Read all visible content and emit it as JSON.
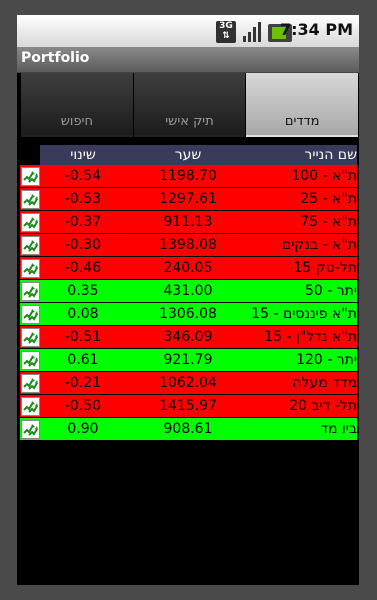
{
  "status_bar": {
    "network": "3G",
    "time": "7:34 PM",
    "icons": [
      "3g-icon",
      "signal-icon",
      "battery-icon"
    ]
  },
  "app": {
    "title": "Portfolio"
  },
  "tabs": [
    {
      "label": "חיפוש",
      "selected": false
    },
    {
      "label": "תיק אישי",
      "selected": false
    },
    {
      "label": "מדדים",
      "selected": true
    }
  ],
  "table": {
    "headers": {
      "name": "שם הנייר",
      "price": "שער",
      "change": "שינוי"
    },
    "rows": [
      {
        "name": "ת\"א - 100",
        "price": "1198.70",
        "change": "-0.54",
        "status": "down"
      },
      {
        "name": "ת\"א - 25",
        "price": "1297.61",
        "change": "-0.53",
        "status": "down"
      },
      {
        "name": "ת\"א - 75",
        "price": "911.13",
        "change": "-0.37",
        "status": "down"
      },
      {
        "name": "ת\"א - בנקים",
        "price": "1398.08",
        "change": "-0.30",
        "status": "down"
      },
      {
        "name": "תל-טק 15",
        "price": "240.05",
        "change": "-0.46",
        "status": "down"
      },
      {
        "name": "יתר - 50",
        "price": "431.00",
        "change": "0.35",
        "status": "up"
      },
      {
        "name": "ת\"א פיננסים - 15",
        "price": "1306.08",
        "change": "0.08",
        "status": "up"
      },
      {
        "name": "ת\"א נדל\"ן - 15",
        "price": "346.09",
        "change": "-0.51",
        "status": "down"
      },
      {
        "name": "יתר - 120",
        "price": "921.79",
        "change": "0.61",
        "status": "up"
      },
      {
        "name": "מדד מעלה",
        "price": "1062.04",
        "change": "-0.21",
        "status": "down"
      },
      {
        "name": "תל- דיב 20",
        "price": "1415.97",
        "change": "-0.50",
        "status": "down"
      },
      {
        "name": "ביו מד",
        "price": "908.61",
        "change": "0.90",
        "status": "up"
      }
    ]
  },
  "colors": {
    "up": "#00ff00",
    "down": "#ff0000",
    "header": "#3a3a5a"
  }
}
